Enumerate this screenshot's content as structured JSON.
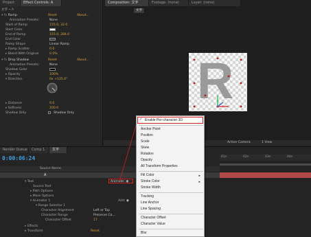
{
  "top_tabs": {
    "project": "Project",
    "effect_controls": "Effect Controls: A",
    "composition": "Composition: 文字",
    "footage": "Footage: (none)",
    "layer": "Layer: (none)"
  },
  "effect_controls": {
    "breadcrumb": "文字 • A",
    "ramp": {
      "name": "Ramp",
      "reset": "Reset",
      "about": "About...",
      "animation_presets_label": "Animation Presets:",
      "animation_presets_value": "None",
      "start_of_ramp_label": "Start of Ramp",
      "start_of_ramp_value": "155.0, 32.0",
      "start_color_label": "Start Color",
      "end_of_ramp_label": "End of Ramp",
      "end_of_ramp_value": "155.0, 284.0",
      "end_color_label": "End Color",
      "ramp_shape_label": "Ramp Shape",
      "ramp_shape_value": "Linear Ramp",
      "ramp_scatter_label": "Ramp Scatter",
      "ramp_scatter_value": "0.0",
      "blend_label": "Blend With Original",
      "blend_value": "0.0%"
    },
    "drop_shadow": {
      "name": "Drop Shadow",
      "reset": "Reset",
      "about": "About...",
      "animation_presets_label": "Animation Presets:",
      "animation_presets_value": "None",
      "shadow_color_label": "Shadow Color",
      "opacity_label": "Opacity",
      "opacity_value": "100%",
      "direction_label": "Direction",
      "direction_value": "0x +135.0°",
      "distance_label": "Distance",
      "distance_value": "0.0",
      "softness_label": "Softness",
      "softness_value": "100.0",
      "shadow_only_label": "Shadow Only",
      "shadow_only_value": "Shadow Only"
    }
  },
  "composition": {
    "breadcrumb": "文字",
    "letter": "R",
    "bottom_bar": {
      "camera": "Active Camera",
      "view": "1 View"
    }
  },
  "timeline": {
    "tabs": [
      "Render Queue",
      "Comp 1",
      "文字"
    ],
    "timecode": "0:00:06:24",
    "source_name_header": "Source Name",
    "ruler": [
      "01s",
      "02s",
      "03s",
      "04s"
    ],
    "layer_letter": "A",
    "animate_label": "Animate:",
    "rows": [
      {
        "label": "Text",
        "value": ""
      },
      {
        "label": "Source Text",
        "value": ""
      },
      {
        "label": "Path Options",
        "value": ""
      },
      {
        "label": "More Options",
        "value": ""
      },
      {
        "label": "Animator 1",
        "value": ""
      },
      {
        "label": "Range Selector 1",
        "value": ""
      },
      {
        "label": "Character Alignment",
        "value": "Left or Top"
      },
      {
        "label": "Character Range",
        "value": "Preserve Ca..."
      },
      {
        "label": "Character Offset",
        "value": "17"
      },
      {
        "label": "Effects",
        "value": ""
      },
      {
        "label": "Transform",
        "value": "Reset"
      }
    ],
    "add_label": "Add:"
  },
  "context_menu": {
    "items": [
      {
        "label": "Enable Per-character 3D",
        "checked": true,
        "highlighted": true
      },
      {
        "label": "Anchor Point"
      },
      {
        "label": "Position"
      },
      {
        "label": "Scale"
      },
      {
        "label": "Skew"
      },
      {
        "label": "Rotation"
      },
      {
        "label": "Opacity"
      },
      {
        "label": "All Transform Properties"
      },
      {
        "label": "Fill Color",
        "submenu": true
      },
      {
        "label": "Stroke Color",
        "submenu": true
      },
      {
        "label": "Stroke Width"
      },
      {
        "label": "Tracking"
      },
      {
        "label": "Line Anchor"
      },
      {
        "label": "Line Spacing"
      },
      {
        "label": "Character Offset"
      },
      {
        "label": "Character Value"
      },
      {
        "label": "Blur"
      }
    ],
    "check_glyph": "✓",
    "submenu_glyph": "▸"
  },
  "colors": {
    "accent_orange": "#d9a23b",
    "highlight_red": "#d02020",
    "timecode_blue": "#3fa0e0",
    "panel_bg": "#232323"
  }
}
